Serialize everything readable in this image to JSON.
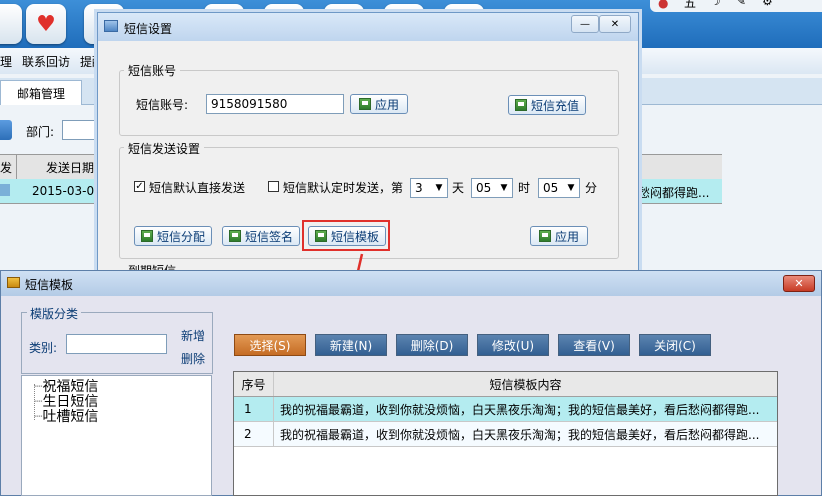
{
  "background_app": {
    "menu_items": [
      "理",
      "联系回访",
      "提醒"
    ],
    "tab": "邮箱管理",
    "dept_label": "部门:",
    "table_headers": [
      "发",
      "发送日期"
    ],
    "table_row": {
      "date": "2015-03-08",
      "content_tail": "愁闷都得跑..."
    }
  },
  "sms_dialog": {
    "title": "短信设置",
    "account_group": "短信账号",
    "account_label": "短信账号:",
    "account_value": "9158091580",
    "apply_button": "应用",
    "recharge_button": "短信充值",
    "send_group": "短信发送设置",
    "default_direct_label": "短信默认直接发送",
    "default_direct_checked": true,
    "default_timed_label": "短信默认定时发送，第",
    "default_timed_checked": false,
    "day_value": "3",
    "day_unit": "天",
    "hour_value": "05",
    "hour_unit": "时",
    "minute_value": "05",
    "minute_unit": "分",
    "assign_button": "短信分配",
    "sign_button": "短信签名",
    "template_button": "短信模板",
    "apply_button2": "应用",
    "expire_label": "到期短信"
  },
  "template_dialog": {
    "title": "短信模板",
    "category_group": "模版分类",
    "category_label": "类别:",
    "category_value": "",
    "add_link": "新增",
    "delete_link": "删除",
    "tree_items": [
      "祝福短信",
      "生日短信",
      "吐槽短信"
    ],
    "toolbar": [
      {
        "label": "选择(S)",
        "selected": true
      },
      {
        "label": "新建(N)",
        "selected": false
      },
      {
        "label": "删除(D)",
        "selected": false
      },
      {
        "label": "修改(U)",
        "selected": false
      },
      {
        "label": "查看(V)",
        "selected": false
      },
      {
        "label": "关闭(C)",
        "selected": false
      }
    ],
    "table_headers": [
      "序号",
      "短信模板内容"
    ],
    "rows": [
      {
        "index": "1",
        "content": "我的祝福最霸道，收到你就没烦恼，白天黑夜乐淘淘；我的短信最美好，看后愁闷都得跑..."
      },
      {
        "index": "2",
        "content": "我的祝福最霸道，收到你就没烦恼，白天黑夜乐淘淘；我的短信最美好，看后愁闷都得跑..."
      }
    ]
  },
  "colors": {
    "highlight_box": "#e0302b",
    "row_selected": "#b4ecf0",
    "title_bar": "#c9dcf1"
  }
}
